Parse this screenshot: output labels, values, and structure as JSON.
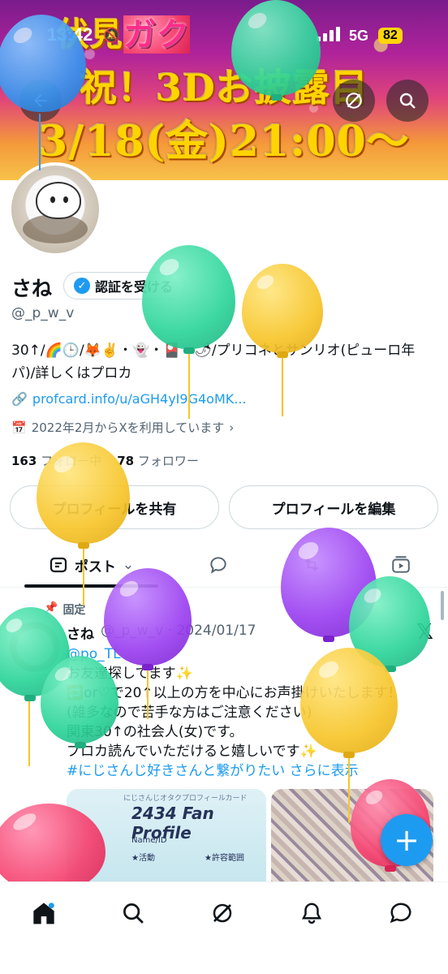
{
  "status_bar": {
    "time": "13:42",
    "network": "5G",
    "battery": "82"
  },
  "banner": {
    "line1_a": "伏見",
    "line1_b": "ガク",
    "line2": "祝！3Dお披露目",
    "line3": "3/18(金)21:00〜"
  },
  "profile": {
    "name": "さね",
    "verify_label": "認証を受ける",
    "handle": "@_p_w_v",
    "bio": "30↑/🌈🕒/🦊✌️・👻・🎴・🌶/プリコネとサンリオ(ピューロ年パ)/詳しくはプロカ",
    "link": "profcard.info/u/aGH4yI9G4oMK...",
    "joined": "2022年2月からXを利用しています",
    "following_count": "163",
    "following_label": "フォロー中",
    "followers_count": "78",
    "followers_label": "フォロワー",
    "share_button": "プロフィールを共有",
    "edit_button": "プロフィールを編集"
  },
  "tabs": {
    "post_label": "ポスト"
  },
  "post": {
    "pinned_label": "固定",
    "author": "さね",
    "meta": "@_p_w_v · 2024/01/17",
    "lines": [
      "@po_TL",
      "お友達探してます✨",
      "🔁or♡で20↑以上の方を中心にお声掛けいたします！",
      "(雑多なので苦手な方はご注意ください)",
      "関東30↑の社会人(女)です。",
      "プロカ読んでいただけると嬉しいです✨"
    ],
    "hashtag": "#にじさんじ好きさんと繋がりたい",
    "show_more": "さらに表示",
    "card_subtitle": "にじさんじオタクプロフィールカード",
    "card_title": "2434 Fan Profile",
    "card_field": "Name/ID",
    "card_row1": "★活動",
    "card_row2": "★許容範囲"
  },
  "fab_label": "+",
  "colors": {
    "accent": "#1d9bf0",
    "text": "#0f1419",
    "muted": "#536471",
    "border": "#cfd9de"
  },
  "icons": [
    "back-arrow-icon",
    "grok-icon",
    "search-icon",
    "verified-badge-icon",
    "link-icon",
    "calendar-icon",
    "pin-icon",
    "x-logo-icon",
    "home-icon",
    "notifications-icon",
    "messages-icon",
    "balloons-decoration"
  ]
}
